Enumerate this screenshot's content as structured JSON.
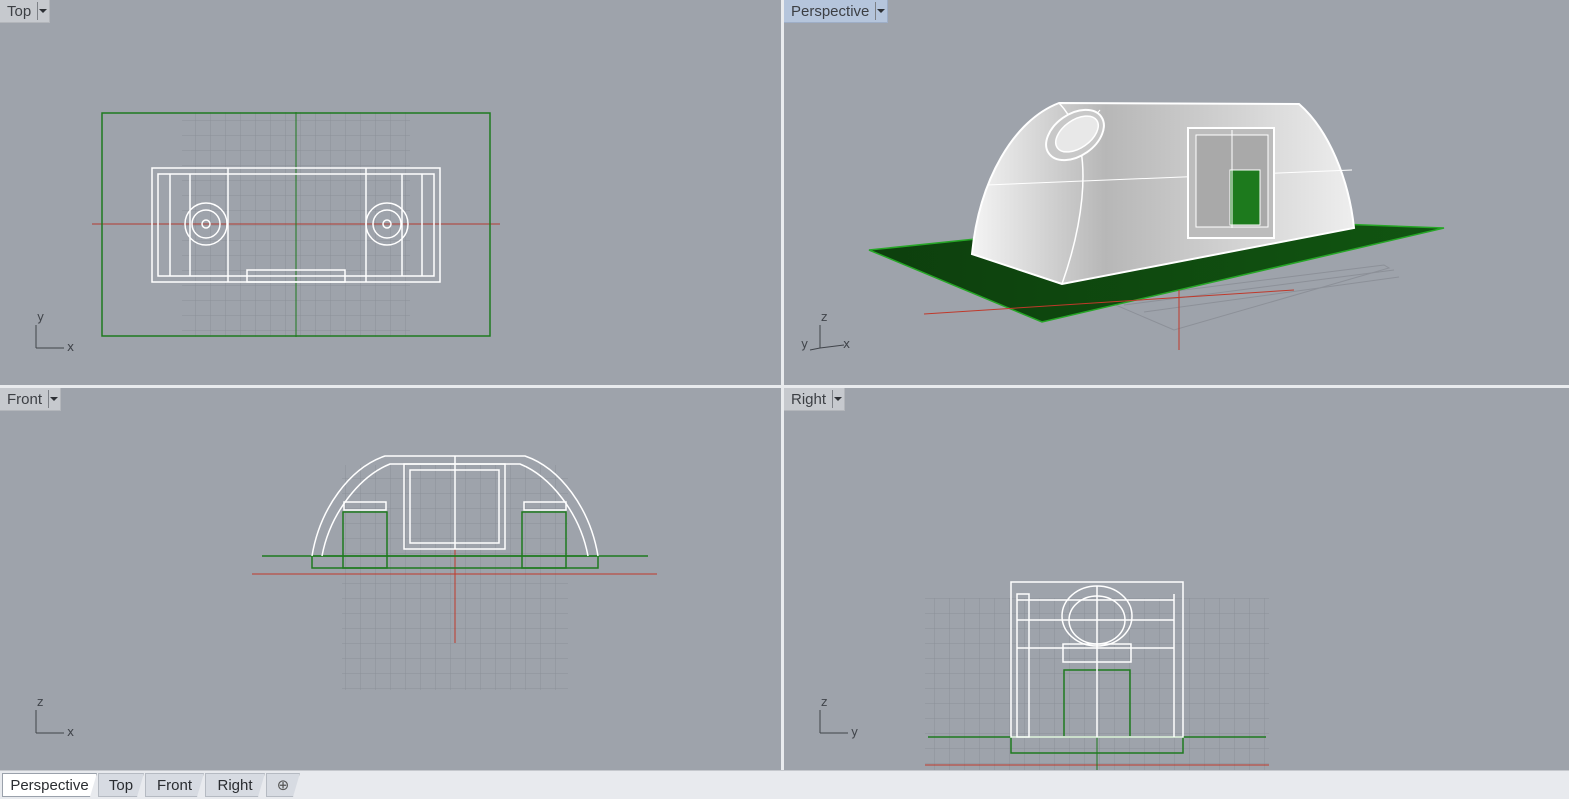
{
  "viewports": {
    "top": {
      "label": "Top",
      "axes": [
        "y",
        "x"
      ]
    },
    "perspective": {
      "label": "Perspective",
      "axes": [
        "z",
        "y",
        "x"
      ]
    },
    "front": {
      "label": "Front",
      "axes": [
        "z",
        "x"
      ]
    },
    "right": {
      "label": "Right",
      "axes": [
        "z",
        "y"
      ]
    }
  },
  "tabs": [
    {
      "label": "Perspective",
      "active": true
    },
    {
      "label": "Top",
      "active": false
    },
    {
      "label": "Front",
      "active": false
    },
    {
      "label": "Right",
      "active": false
    }
  ],
  "add_tab_icon": "plus-icon",
  "colors": {
    "viewport_bg": "#9ea3ab",
    "wire": "#ffffff",
    "plane": "#1a7a1a",
    "x_axis": "#c0392b",
    "grid": "#8c9098"
  }
}
